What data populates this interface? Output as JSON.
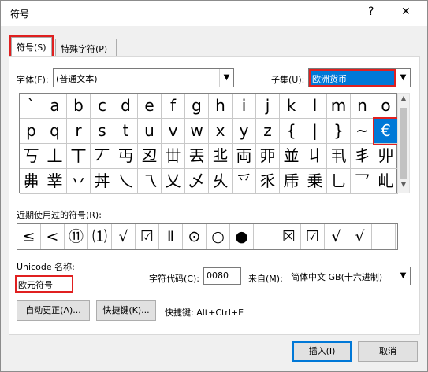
{
  "window": {
    "title": "符号",
    "help": "?",
    "close": "✕"
  },
  "tabs": [
    {
      "label": "符号(S)",
      "active": true
    },
    {
      "label": "特殊字符(P)",
      "active": false
    }
  ],
  "font": {
    "label": "字体(F):",
    "value": "(普通文本)"
  },
  "subset": {
    "label": "子集(U):",
    "value": "欧洲货币"
  },
  "symbol_grid": {
    "rows": [
      [
        "`",
        "a",
        "b",
        "c",
        "d",
        "e",
        "f",
        "g",
        "h",
        "i",
        "j",
        "k",
        "l",
        "m",
        "n",
        "o"
      ],
      [
        "p",
        "q",
        "r",
        "s",
        "t",
        "u",
        "v",
        "w",
        "x",
        "y",
        "z",
        "{",
        "|",
        "}",
        "~",
        "€"
      ],
      [
        "丂",
        "丄",
        "丅",
        "丆",
        "丏",
        "丒",
        "丗",
        "丟",
        "丠",
        "両",
        "丣",
        "並",
        "丩",
        "丮",
        "丯",
        "丱"
      ],
      [
        "丳",
        "丵",
        "丷",
        "丼",
        "乀",
        "乁",
        "乂",
        "乄",
        "乆",
        "乊",
        "乑",
        "乕",
        "乗",
        "乚",
        "乛",
        "乢"
      ]
    ],
    "selected": "€"
  },
  "recent": {
    "label": "近期使用过的符号(R):",
    "symbols": [
      "≤",
      "<",
      "⑪",
      "⑴",
      "√",
      "☑",
      "Ⅱ",
      "⊙",
      "○",
      "●",
      "",
      "☒",
      "☑",
      "√",
      "√",
      ""
    ]
  },
  "unicode": {
    "label": "Unicode 名称:",
    "value": "欧元符号"
  },
  "char_code": {
    "label": "字符代码(C):",
    "value": "0080"
  },
  "from": {
    "label": "来自(M):",
    "value": "简体中文 GB(十六进制)"
  },
  "buttons": {
    "autocorrect": "自动更正(A)...",
    "shortcut_key": "快捷键(K)...",
    "shortcut_text": "快捷键: Alt+Ctrl+E",
    "insert": "插入(I)",
    "cancel": "取消"
  }
}
